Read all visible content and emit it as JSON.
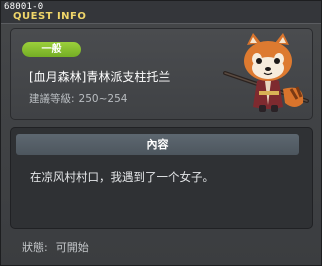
{
  "window": {
    "quest_id": "68001-0",
    "title": "QUEST INFO"
  },
  "header": {
    "category": "一般",
    "quest_name": "[血月森林]青林派支柱托兰",
    "level_label": "建議等級:",
    "level_range": "250~254"
  },
  "content": {
    "header": "內容",
    "text": "在凉风村村口，我遇到了一个女子。"
  },
  "status": {
    "label": "狀態:",
    "value": "可開始"
  },
  "colors": {
    "title": "#f0d66a",
    "badge": "#8cc433",
    "panel": "#2f3134",
    "content_header": "#56606a"
  },
  "icons": [
    "red-panda-npc-icon"
  ]
}
